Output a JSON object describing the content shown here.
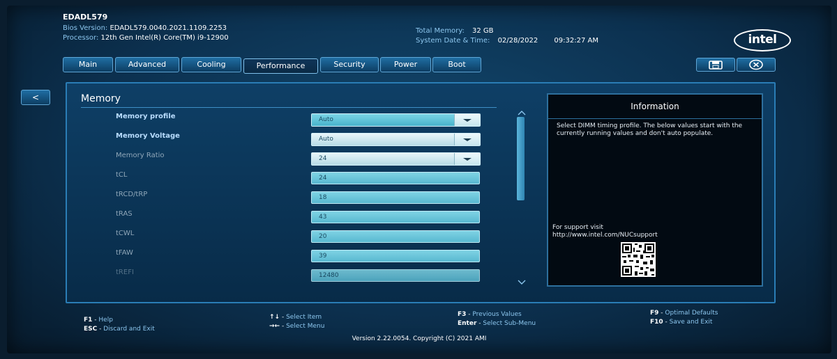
{
  "header": {
    "model": "EDADL579",
    "bios_label": "Bios Version:",
    "bios_value": "EDADL579.0040.2021.1109.2253",
    "processor_label": "Processor:",
    "processor_value": "12th Gen Intel(R) Core(TM) i9-12900",
    "memory_label": "Total Memory:",
    "memory_value": "32 GB",
    "datetime_label": "System Date & Time:",
    "date_value": "02/28/2022",
    "time_value": "09:32:27 AM",
    "logo_text": "intel"
  },
  "tabs": [
    {
      "label": "Main"
    },
    {
      "label": "Advanced"
    },
    {
      "label": "Cooling"
    },
    {
      "label": "Performance"
    },
    {
      "label": "Security"
    },
    {
      "label": "Power"
    },
    {
      "label": "Boot"
    }
  ],
  "active_tab": "Performance",
  "toolbar": {
    "save_icon": "save-icon",
    "exit_icon": "exit-icon",
    "back_label": "<"
  },
  "section": {
    "title": "Memory",
    "rows": [
      {
        "label": "Memory profile",
        "value": "Auto",
        "type": "select"
      },
      {
        "label": "Memory Voltage",
        "value": "Auto",
        "type": "select"
      },
      {
        "label": "Memory Ratio",
        "value": "24",
        "type": "select"
      },
      {
        "label": "tCL",
        "value": "24",
        "type": "field"
      },
      {
        "label": "tRCD/tRP",
        "value": "18",
        "type": "field"
      },
      {
        "label": "tRAS",
        "value": "43",
        "type": "field"
      },
      {
        "label": "tCWL",
        "value": "20",
        "type": "field"
      },
      {
        "label": "tFAW",
        "value": "39",
        "type": "field"
      },
      {
        "label": "tREFI",
        "value": "12480",
        "type": "field"
      }
    ]
  },
  "info": {
    "title": "Information",
    "text": "Select DIMM timing profile. The below values start with the currently running values and don't auto populate.",
    "support_line1": "For support visit",
    "support_line2": "http://www.intel.com/NUCsupport"
  },
  "footer": {
    "col1": [
      {
        "key": "F1",
        "desc": "Help"
      },
      {
        "key": "ESC",
        "desc": "Discard and Exit"
      }
    ],
    "col2": [
      {
        "key": "↑↓",
        "desc": "Select Item"
      },
      {
        "key": "→←",
        "desc": "Select Menu"
      }
    ],
    "col3": [
      {
        "key": "F3",
        "desc": "Previous Values"
      },
      {
        "key": "Enter",
        "desc": "Select Sub-Menu"
      }
    ],
    "col4": [
      {
        "key": "F9",
        "desc": "Optimal Defaults"
      },
      {
        "key": "F10",
        "desc": "Save and Exit"
      }
    ],
    "version": "Version 2.22.0054. Copyright (C) 2021 AMI"
  }
}
